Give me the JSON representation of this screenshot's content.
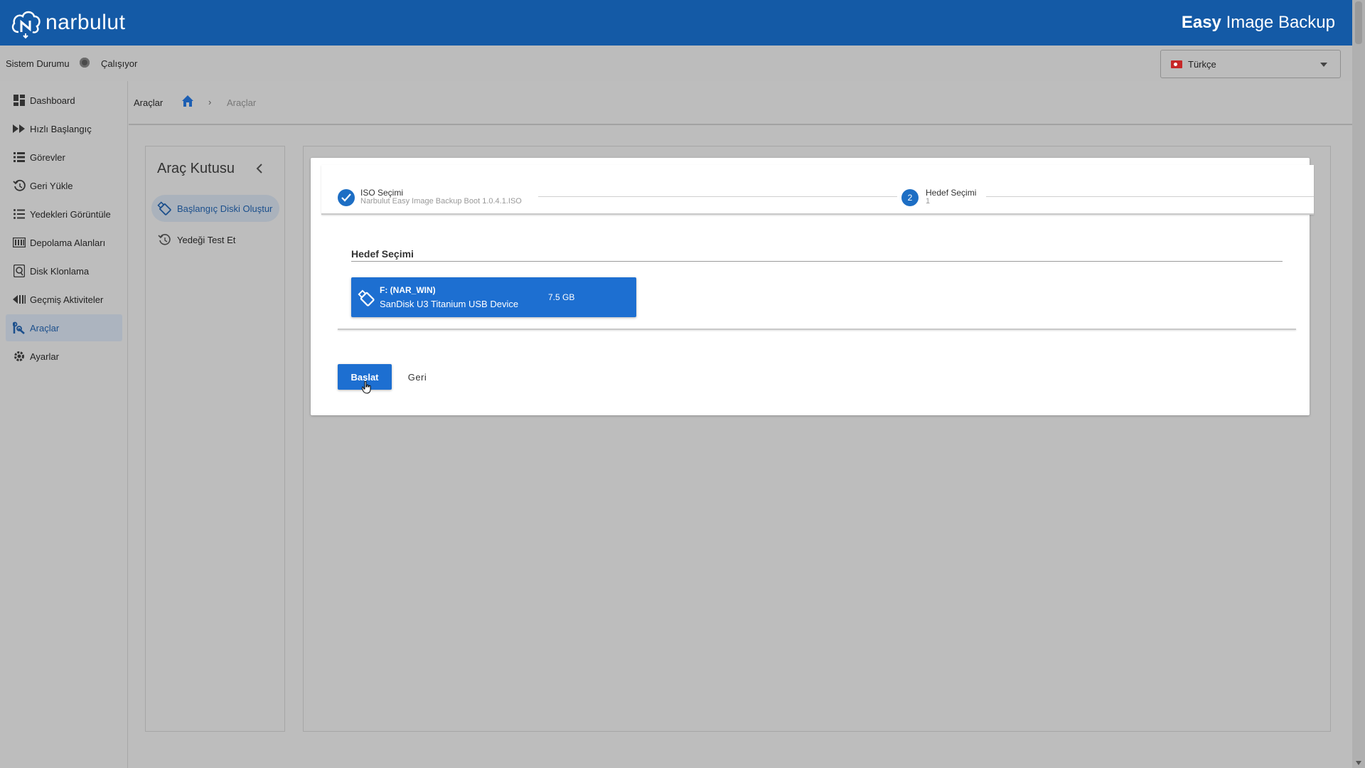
{
  "header": {
    "logo_text": "narbulut",
    "app_title_bold": "Easy",
    "app_title_rest": " Image Backup",
    "color": "#145aa6"
  },
  "status": {
    "label": "Sistem Durumu",
    "value": "Çalışıyor"
  },
  "language": {
    "selected": "Türkçe",
    "flag_icon": "turkey-flag-icon"
  },
  "sidebar": {
    "items": [
      {
        "label": "Dashboard",
        "icon": "dashboard-icon"
      },
      {
        "label": "Hızlı Başlangıç",
        "icon": "fast-forward-icon"
      },
      {
        "label": "Görevler",
        "icon": "list-icon"
      },
      {
        "label": "Geri Yükle",
        "icon": "restore-icon"
      },
      {
        "label": "Yedekleri Görüntüle",
        "icon": "list-view-icon"
      },
      {
        "label": "Depolama Alanları",
        "icon": "storage-icon"
      },
      {
        "label": "Disk Klonlama",
        "icon": "disk-clone-icon"
      },
      {
        "label": "Geçmiş Aktiviteler",
        "icon": "history-icon"
      },
      {
        "label": "Araçlar",
        "icon": "tools-icon",
        "active": true
      },
      {
        "label": "Ayarlar",
        "icon": "gear-icon"
      }
    ]
  },
  "breadcrumb": {
    "title": "Araçlar",
    "current": "Araçlar",
    "separator": "›"
  },
  "toolbox": {
    "title": "Araç Kutusu",
    "items": [
      {
        "label": "Başlangıç Diski Oluştur",
        "icon": "usb-drive-icon",
        "active": true
      },
      {
        "label": "Yedeği Test Et",
        "icon": "restore-icon"
      }
    ]
  },
  "stepper": {
    "step1": {
      "title": "ISO Seçimi",
      "subtitle": "Narbulut Easy Image Backup Boot 1.0.4.1.ISO"
    },
    "step2": {
      "number": "2",
      "title": "Hedef Seçimi",
      "subtitle": "1"
    }
  },
  "target": {
    "section_title": "Hedef Seçimi",
    "device": {
      "name": "F: (NAR_WIN)",
      "model": "SanDisk U3 Titanium USB Device",
      "size": "7.5 GB"
    }
  },
  "actions": {
    "start_label": "Başlat",
    "back_label": "Geri"
  },
  "colors": {
    "accent": "#1d6fd1",
    "active_text": "#1b4f8c"
  }
}
